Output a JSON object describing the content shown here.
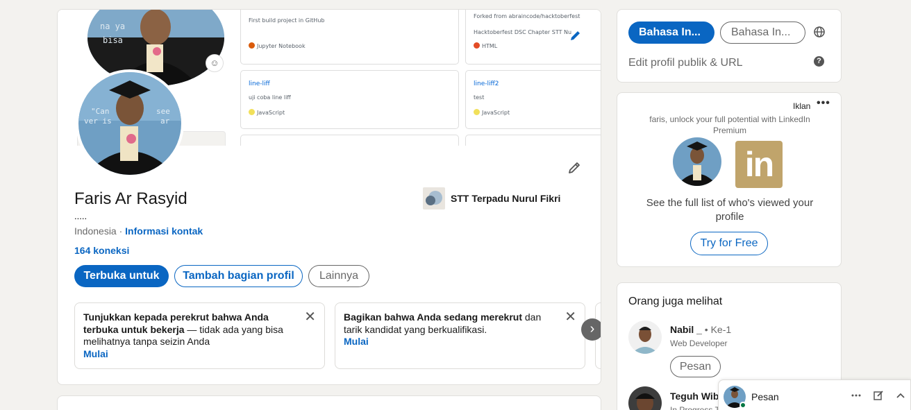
{
  "cover": {
    "repos": [
      {
        "name": "",
        "desc": "First build project in GitHub",
        "lang": "Jupyter Notebook",
        "lang_color": "#da5b0b"
      },
      {
        "name": "",
        "desc": "Forked from abraincode/hacktoberfest",
        "desc2": "Hacktoberfest DSC Chapter STT Nu",
        "lang": "HTML",
        "lang_color": "#e34c26"
      },
      {
        "name": "line-liff",
        "desc": "uji coba line liff",
        "lang": "JavaScript",
        "lang_color": "#f1e05a"
      },
      {
        "name": "line-liff2",
        "desc": "test",
        "lang": "JavaScript",
        "lang_color": "#f1e05a"
      }
    ]
  },
  "profile": {
    "name": "Faris Ar Rasyid",
    "headline": ".....",
    "location": "Indonesia · ",
    "contact_link": "Informasi kontak",
    "connections": "164 koneksi",
    "education": "STT Terpadu Nurul Fikri",
    "buttons": {
      "open_to": "Terbuka untuk",
      "add_section": "Tambah bagian profil",
      "more": "Lainnya"
    }
  },
  "prompts": [
    {
      "bold": "Tunjukkan kepada perekrut bahwa Anda terbuka untuk bekerja",
      "rest": " — tidak ada yang bisa melihatnya tanpa seizin Anda",
      "action": "Mulai"
    },
    {
      "bold": "Bagikan bahwa Anda sedang merekrut",
      "rest": " dan tarik kandidat yang berkualifikasi.",
      "action": "Mulai"
    }
  ],
  "sidebar": {
    "lang_active": "Bahasa In...",
    "lang_other": "Bahasa In...",
    "public_url": "Edit profil publik & URL",
    "ad": {
      "label": "Iklan",
      "sub": "faris, unlock your full potential with LinkedIn Premium",
      "logo_text": "in",
      "text": "See the full list of who's viewed your profile",
      "cta": "Try for Free"
    },
    "people": {
      "title": "Orang juga melihat",
      "items": [
        {
          "name": "Nabil _",
          "degree": " • Ke-1",
          "role": "Web Developer",
          "action": "Pesan"
        },
        {
          "name": "Teguh Wib",
          "degree": "",
          "role": "In Progress T",
          "action": ""
        }
      ]
    }
  },
  "messaging": {
    "title": "Pesan"
  },
  "colors": {
    "brand": "#0a66c2",
    "background": "#f3f2ef",
    "premium_gold": "#c0a46b",
    "online": "#057642"
  }
}
